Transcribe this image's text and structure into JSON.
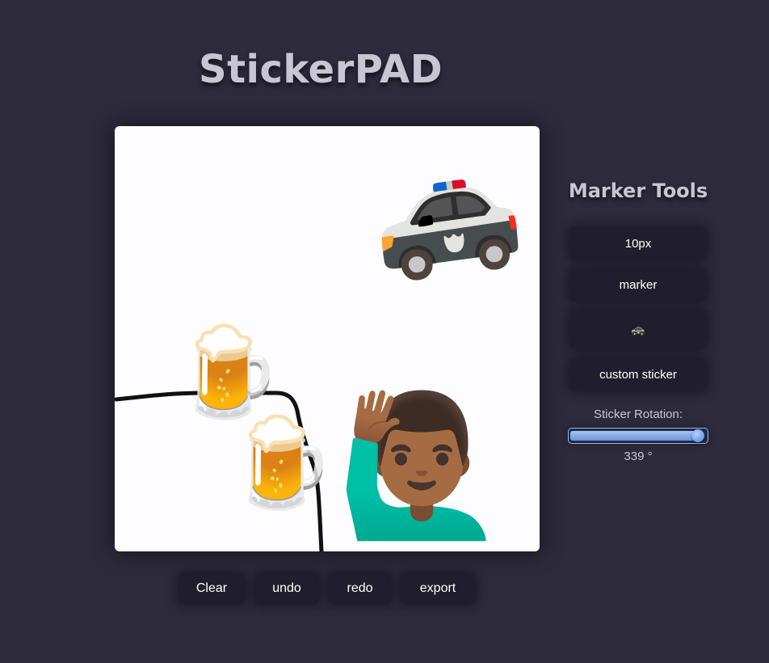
{
  "app": {
    "title": "StickerPAD"
  },
  "canvas": {
    "stickers": [
      {
        "name": "police-car",
        "glyph": "🚓"
      },
      {
        "name": "beer-mug",
        "glyph": "🍺"
      },
      {
        "name": "beer-mug",
        "glyph": "🍺"
      },
      {
        "name": "man-raising-hand",
        "glyph": "🙋🏾‍♂️"
      }
    ]
  },
  "tools": {
    "heading": "Marker Tools",
    "size_label": "10px",
    "mode_label": "marker",
    "sticker_glyph": "🚓",
    "custom_label": "custom sticker",
    "rotation_label": "Sticker Rotation:",
    "rotation_value": 339,
    "rotation_max": 360,
    "rotation_text": "339 °"
  },
  "actions": {
    "clear": "Clear",
    "undo": "undo",
    "redo": "redo",
    "export": "export"
  },
  "colors": {
    "background": "#2c2a3b",
    "button": "#201e2d",
    "title": "#c9c6d4",
    "canvas": "#fdfcff",
    "stroke": "#111111"
  }
}
